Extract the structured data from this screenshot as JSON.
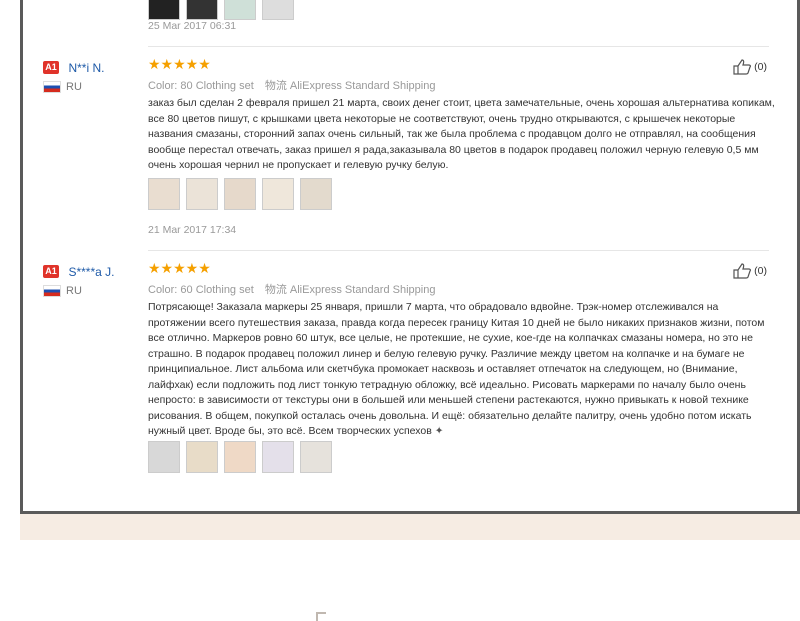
{
  "top_review": {
    "date": "25 Mar 2017 06:31"
  },
  "reviews": [
    {
      "level": "A1",
      "name": "N**i N.",
      "country": "RU",
      "stars": "★★★★★",
      "color_label": "Color: 80 Clothing set",
      "ship_prefix": "物流",
      "shipping": "AliExpress Standard Shipping",
      "helpful": "(0)",
      "text": "заказ был сделан 2 февраля пришел 21 марта, своих денег стоит, цвета замечательные, очень хорошая альтернатива копикам, все 80 цветов пишут, с крышками цвета некоторые не соответствуют, очень трудно открываются, с крышечек некоторые названия смазаны, сторонний запах очень сильный, так же была проблема с продавцом долго не отправлял, на сообщения вообще перестал отвечать, заказ пришел я рада,заказывала 80 цветов в подарок продавец положил черную гелевую 0,5 мм очень хорошая чернил не пропускает и гелевую ручку белую.",
      "date": "21 Mar 2017 17:34"
    },
    {
      "level": "A1",
      "name": "S****a J.",
      "country": "RU",
      "stars": "★★★★★",
      "color_label": "Color: 60 Clothing set",
      "ship_prefix": "物流",
      "shipping": "AliExpress Standard Shipping",
      "helpful": "(0)",
      "text": "Потрясающе! Заказала маркеры 25 января, пришли 7 марта, что обрадовало вдвойне. Трэк-номер отслеживался на протяжении всего путешествия заказа, правда когда пересек границу Китая 10 дней не было никаких признаков жизни, потом все отлично. Маркеров ровно 60 штук, все целые, не протекшие, не сухие, кое-где на колпачках смазаны номера, но это не страшно. В подарок продавец положил линер и белую гелевую ручку. Различие между цветом на колпачке и на бумаге не принципиальное. Лист альбома или скетчбука промокает насквозь и оставляет отпечаток на следующем, но (Внимание, лайфхак) если подложить под лист тонкую тетрадную обложку, всё идеально. Рисовать маркерами по началу было очень непросто: в зависимости от текстуры они в большей или меньшей степени растекаются, нужно привыкать к новой технике рисования. В общем, покупкой осталась очень довольна. И ещё: обязательно делайте палитру, очень удобно потом искать нужный цвет. Вроде бы, это всё. Всем творческих успехов"
    }
  ],
  "colors": {
    "level_badge": "#e0332a",
    "username": "#1e5aa8",
    "star": "#f5a000",
    "beige_strip": "#f6ece3"
  }
}
